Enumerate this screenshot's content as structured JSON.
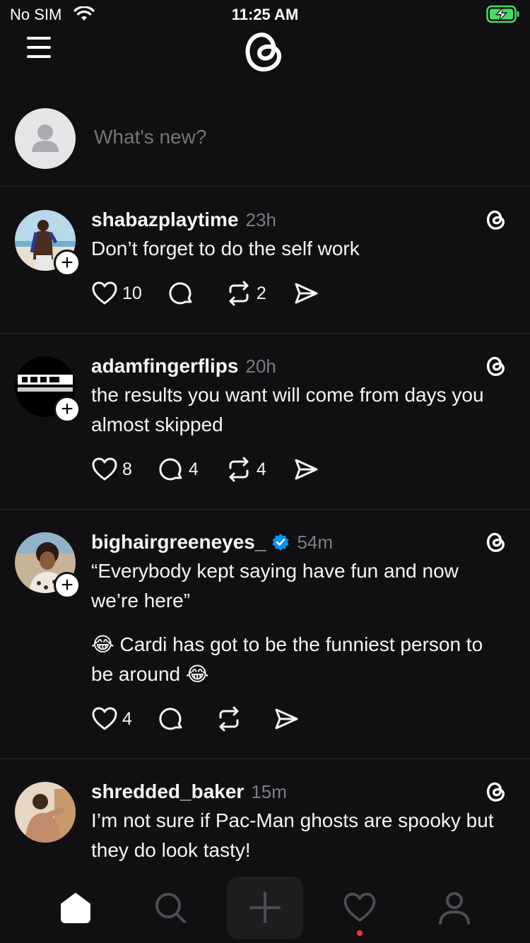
{
  "status_bar": {
    "carrier": "No SIM",
    "time": "11:25 AM"
  },
  "composer": {
    "placeholder": "What's new?"
  },
  "posts": [
    {
      "username": "shabazplaytime",
      "time": "23h",
      "verified": false,
      "text": [
        "Don’t forget to do the self work"
      ],
      "likes": "10",
      "comments": "",
      "reposts": "2",
      "avatar": "photo-man-beach"
    },
    {
      "username": "adamfingerflips",
      "time": "20h",
      "verified": false,
      "text": [
        "the results you want will come from days you almost skipped"
      ],
      "likes": "8",
      "comments": "4",
      "reposts": "4",
      "avatar": "logo-adam-fingerflips"
    },
    {
      "username": "bighairgreeneyes_",
      "time": "54m",
      "verified": true,
      "text": [
        "“Everybody kept saying have fun and now we’re here”",
        "😂 Cardi has got to be the funniest person to be around 😂"
      ],
      "likes": "4",
      "comments": "",
      "reposts": "",
      "avatar": "photo-woman"
    },
    {
      "username": "shredded_baker",
      "time": "15m",
      "verified": false,
      "text": [
        "I’m not sure if Pac-Man ghosts are spooky but they do look tasty!"
      ],
      "likes": "",
      "comments": "",
      "reposts": "",
      "avatar": "photo-baker"
    }
  ],
  "colors": {
    "background": "#101012",
    "text": "#f3f5f7",
    "muted": "#7b7d82",
    "verified": "#0095f6",
    "notification_dot": "#ff3040",
    "battery": "#4cd964"
  },
  "tabs": [
    "home-icon",
    "search-icon",
    "new-post-icon",
    "activity-icon",
    "profile-icon"
  ]
}
